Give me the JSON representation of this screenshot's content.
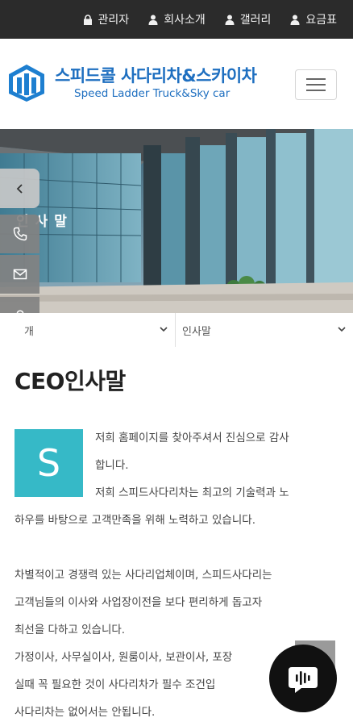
{
  "topbar": {
    "items": [
      {
        "label": "관리자",
        "icon": "lock-icon"
      },
      {
        "label": "회사소개",
        "icon": "user-icon"
      },
      {
        "label": "갤러리",
        "icon": "user-icon"
      },
      {
        "label": "요금표",
        "icon": "user-icon"
      }
    ]
  },
  "header": {
    "brand_ko": "스피드콜 사다리차&스카이차",
    "brand_en": "Speed Ladder Truck&Sky car",
    "logo_color": "#1e6fc0"
  },
  "banner": {
    "title": "인사말"
  },
  "side_menu": {
    "arrow": "chevron-left-icon",
    "buttons": [
      "phone-icon",
      "mail-icon",
      "user-icon"
    ]
  },
  "selects": {
    "first": "개",
    "second": "인사말"
  },
  "content": {
    "title": "CEO인사말",
    "drop_cap": "S",
    "drop_cap_color": "#36b9c7",
    "lines": [
      "저희 홈페이지를 찾아주셔서 진심으로 감사",
      "합니다.",
      "저희 스피드사다리차는 최고의 기술력과 노",
      "하우를 바탕으로 고객만족을 위해 노력하고 있습니다.",
      "차별적이고 경쟁력 있는 사다리업체이며, 스피드사다리는",
      "고객님들의 이사와 사업장이전을 보다 편리하게 돕고자",
      "최선을 다하고 있습니다.",
      "가정이사, 사무실이사, 원룸이사, 보관이사, 포장",
      "실때 꼭 필요한 것이 사다리차가 필수 조건입",
      "사다리차는 없어서는 안됩니다."
    ]
  },
  "chat": {
    "icon": "chat-icon"
  }
}
